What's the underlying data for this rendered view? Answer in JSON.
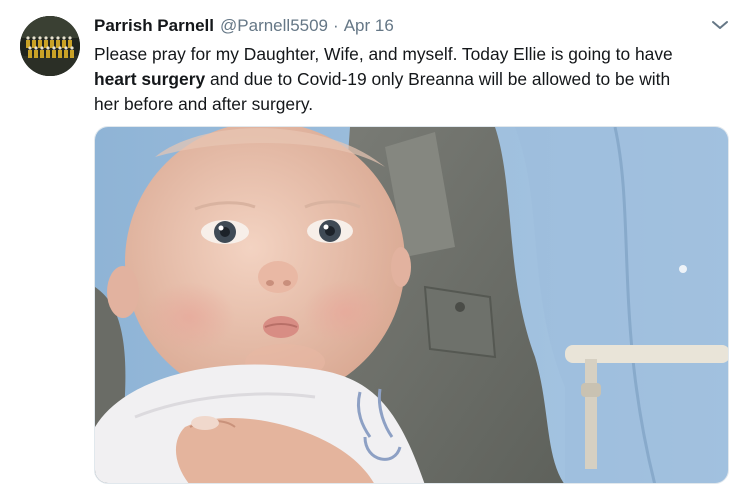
{
  "tweet": {
    "author_name": "Parrish Parnell",
    "author_handle": "@Parnell5509",
    "separator": "·",
    "date": "Apr 16",
    "text_line1": "Please pray for my Daughter, Wife, and myself. Today Ellie is going to have",
    "text_bold": "heart surgery",
    "text_line2_rest": " and due to Covid-19 only Breanna will be allowed to be with",
    "text_line3": "her before and after surgery."
  },
  "icons": {
    "avatar": "team-photo-avatar",
    "menu": "chevron-down-icon"
  },
  "colors": {
    "name": "#14171a",
    "secondary": "#657786",
    "border": "#e1e8ed",
    "accent": "#1da1f2"
  }
}
